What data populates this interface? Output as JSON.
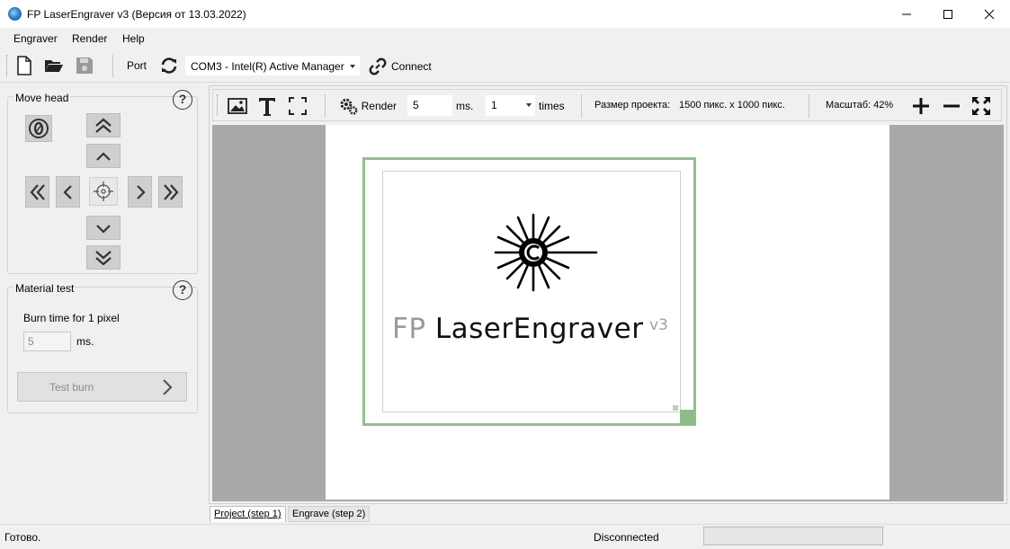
{
  "window": {
    "title": "FP LaserEngraver v3 (Версия от 13.03.2022)"
  },
  "menu": {
    "items": [
      "Engraver",
      "Render",
      "Help"
    ]
  },
  "toolbar": {
    "port_label": "Port",
    "port_value": "COM3 - Intel(R) Active Manager",
    "connect_label": "Connect"
  },
  "move_head": {
    "title": "Move head",
    "help": "?"
  },
  "material_test": {
    "title": "Material test",
    "help": "?",
    "burn_time_label": "Burn time for 1 pixel",
    "burn_time_value": "5",
    "burn_time_unit": "ms.",
    "test_burn_label": "Test burn"
  },
  "canvas_toolbar": {
    "render_label": "Render",
    "ms_value": "5",
    "ms_unit": "ms.",
    "times_value": "1",
    "times_label": "times",
    "project_size_label": "Размер проекта:",
    "project_size_value": "1500 пикс. x 1000 пикс.",
    "zoom_label": "Масштаб: 42%"
  },
  "logo": {
    "fp": "FP ",
    "name": "LaserEngraver",
    "version": "v3"
  },
  "tabs": [
    "Project (step 1)",
    "Engrave (step 2)"
  ],
  "status": {
    "text": "Готово.",
    "connection": "Disconnected",
    "progress": 0
  },
  "colors": {
    "selection": "#92c08e",
    "workspace": "#a9a9a9",
    "progress": "#06b025"
  }
}
